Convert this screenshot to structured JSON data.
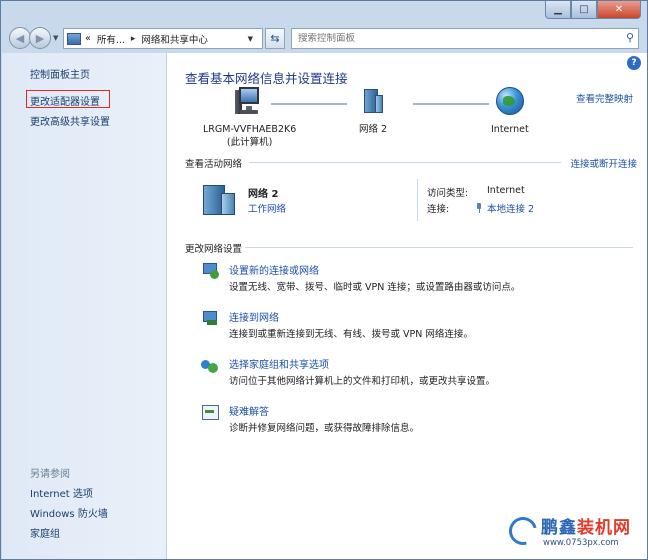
{
  "toolbar": {
    "breadcrumb_overflow": "«",
    "breadcrumb": [
      "所有...",
      "网络和共享中心"
    ],
    "search_placeholder": "搜索控制面板"
  },
  "sidebar": {
    "home": "控制面板主页",
    "adapter_settings": "更改适配器设置",
    "advanced_sharing": "更改高级共享设置",
    "see_also_heading": "另请参阅",
    "see_also": [
      "Internet 选项",
      "Windows 防火墙",
      "家庭组"
    ]
  },
  "main": {
    "title": "查看基本网络信息并设置连接",
    "see_full_map": "查看完整映射",
    "map": {
      "computer_name": "LRGM-VVFHAEB2K6",
      "computer_sub": "(此计算机)",
      "network": "网络  2",
      "internet": "Internet"
    },
    "active_networks_heading": "查看活动网络",
    "connect_disconnect": "连接或断开连接",
    "active_network": {
      "name": "网络  2",
      "type": "工作网络",
      "access_type_label": "访问类型:",
      "access_type_value": "Internet",
      "connections_label": "连接:",
      "connections_value": "本地连接 2"
    },
    "change_settings_heading": "更改网络设置",
    "tasks": [
      {
        "title": "设置新的连接或网络",
        "desc": "设置无线、宽带、拨号、临时或 VPN 连接；或设置路由器或访问点。",
        "icon": "new-connection-icon"
      },
      {
        "title": "连接到网络",
        "desc": "连接到或重新连接到无线、有线、拨号或 VPN 网络连接。",
        "icon": "connect-network-icon"
      },
      {
        "title": "选择家庭组和共享选项",
        "desc": "访问位于其他网络计算机上的文件和打印机，或更改共享设置。",
        "icon": "homegroup-icon"
      },
      {
        "title": "疑难解答",
        "desc": "诊断并修复网络问题，或获得故障排除信息。",
        "icon": "troubleshoot-icon"
      }
    ]
  },
  "watermark": {
    "brand_a": "鹏鑫",
    "brand_b": "装机网",
    "url": "www.0753px.com"
  },
  "colors": {
    "link": "#1b4fa8",
    "title": "#1e3a8a",
    "highlight": "#e4291f"
  }
}
